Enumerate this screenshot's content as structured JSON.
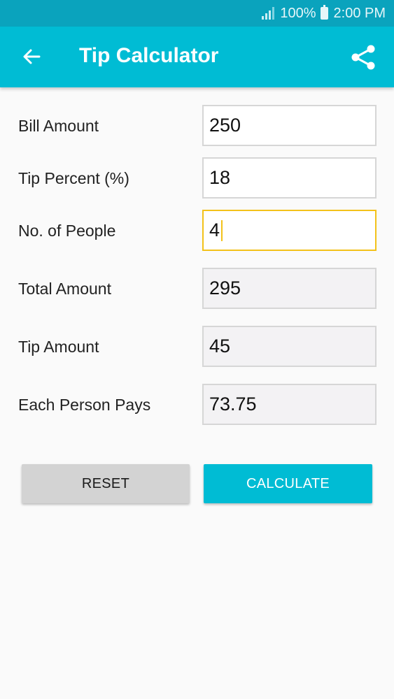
{
  "status_bar": {
    "battery": "100%",
    "time": "2:00 PM"
  },
  "app_bar": {
    "title": "Tip Calculator",
    "back_icon": "arrow-back-icon",
    "share_icon": "share-icon"
  },
  "form": {
    "bill_amount": {
      "label": "Bill Amount",
      "value": "250"
    },
    "tip_percent": {
      "label": "Tip Percent (%)",
      "value": "18"
    },
    "people": {
      "label": "No. of People",
      "value": "4"
    },
    "total_amount": {
      "label": "Total Amount",
      "value": "295"
    },
    "tip_amount": {
      "label": "Tip Amount",
      "value": "45"
    },
    "each_person": {
      "label": "Each Person Pays",
      "value": "73.75"
    }
  },
  "buttons": {
    "reset": "RESET",
    "calculate": "CALCULATE"
  },
  "colors": {
    "primary": "#00bcd4",
    "status_bar": "#0aa3bd",
    "focus": "#f3c21a"
  }
}
